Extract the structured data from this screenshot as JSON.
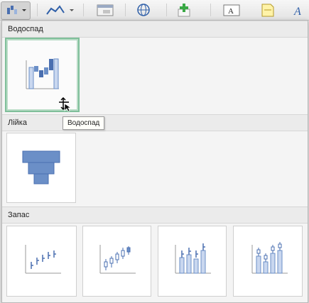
{
  "sections": [
    {
      "title": "Водоспад",
      "charts": [
        {
          "icon": "waterfall-chart-icon"
        }
      ]
    },
    {
      "title": "Лійка",
      "charts": [
        {
          "icon": "funnel-chart-icon"
        }
      ]
    },
    {
      "title": "Запас",
      "charts": [
        {
          "icon": "stock-high-low-close-icon"
        },
        {
          "icon": "stock-open-high-low-close-icon"
        },
        {
          "icon": "stock-volume-high-low-close-icon"
        },
        {
          "icon": "stock-volume-open-high-low-close-icon"
        }
      ]
    }
  ],
  "tooltip": "Водоспад",
  "colors": {
    "accent_selected": "#7fbf9a",
    "chart_fill": "#6b8fc7",
    "chart_light": "#c9d7ef",
    "toolbar_green": "#3aa845"
  }
}
